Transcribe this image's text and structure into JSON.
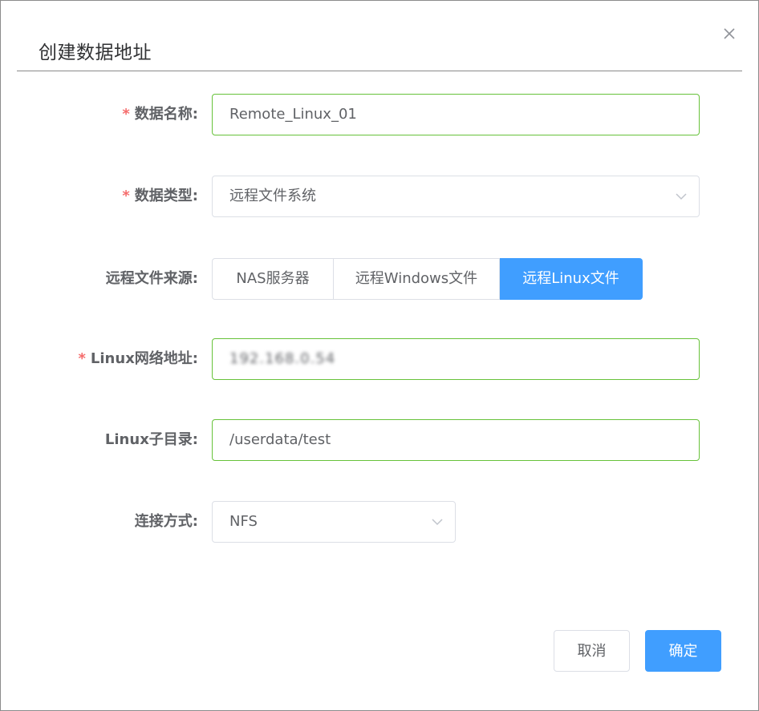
{
  "dialog": {
    "title": "创建数据地址",
    "close_icon": "close-icon"
  },
  "form": {
    "name": {
      "required": "*",
      "label": "数据名称:",
      "value": "Remote_Linux_01"
    },
    "type": {
      "required": "*",
      "label": "数据类型:",
      "value": "远程文件系统",
      "icon": "chevron-down-icon"
    },
    "source": {
      "label": "远程文件来源:",
      "options": [
        "NAS服务器",
        "远程Windows文件",
        "远程Linux文件"
      ],
      "selected": "远程Linux文件"
    },
    "linux_address": {
      "required": "*",
      "label": "Linux网络地址:",
      "value": "192.168.0.54"
    },
    "linux_subdir": {
      "label": "Linux子目录:",
      "value": "/userdata/test"
    },
    "connection": {
      "label": "连接方式:",
      "value": "NFS",
      "icon": "chevron-down-icon"
    }
  },
  "footer": {
    "cancel_label": "取消",
    "confirm_label": "确定"
  },
  "colors": {
    "primary": "#409eff",
    "success_border": "#67c23a",
    "required": "#f56c6c"
  }
}
